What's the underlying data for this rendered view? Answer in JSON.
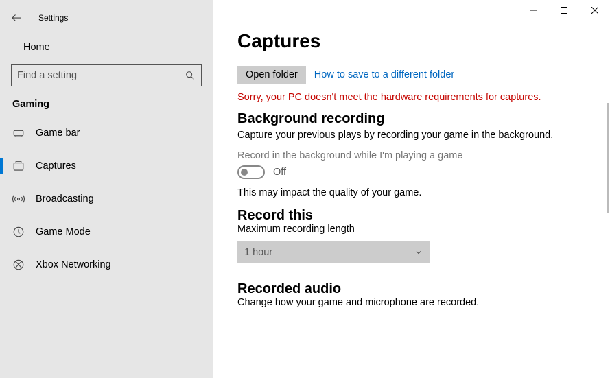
{
  "app_title": "Settings",
  "home_label": "Home",
  "search_placeholder": "Find a setting",
  "gaming_label": "Gaming",
  "nav": {
    "game_bar": "Game bar",
    "captures": "Captures",
    "broadcasting": "Broadcasting",
    "game_mode": "Game Mode",
    "xbox_networking": "Xbox Networking"
  },
  "page": {
    "title": "Captures",
    "open_folder": "Open folder",
    "link_text": "How to save to a different folder",
    "error": "Sorry, your PC doesn't meet the hardware requirements for captures.",
    "bg_title": "Background recording",
    "bg_desc": "Capture your previous plays by recording your game in the background.",
    "bg_toggle_label": "Record in the background while I'm playing a game",
    "toggle_state": "Off",
    "bg_impact": "This may impact the quality of your game.",
    "record_this": "Record this",
    "max_length_label": "Maximum recording length",
    "dropdown_value": "1 hour",
    "recorded_audio_title": "Recorded audio",
    "recorded_audio_desc": "Change how your game and microphone are recorded."
  }
}
